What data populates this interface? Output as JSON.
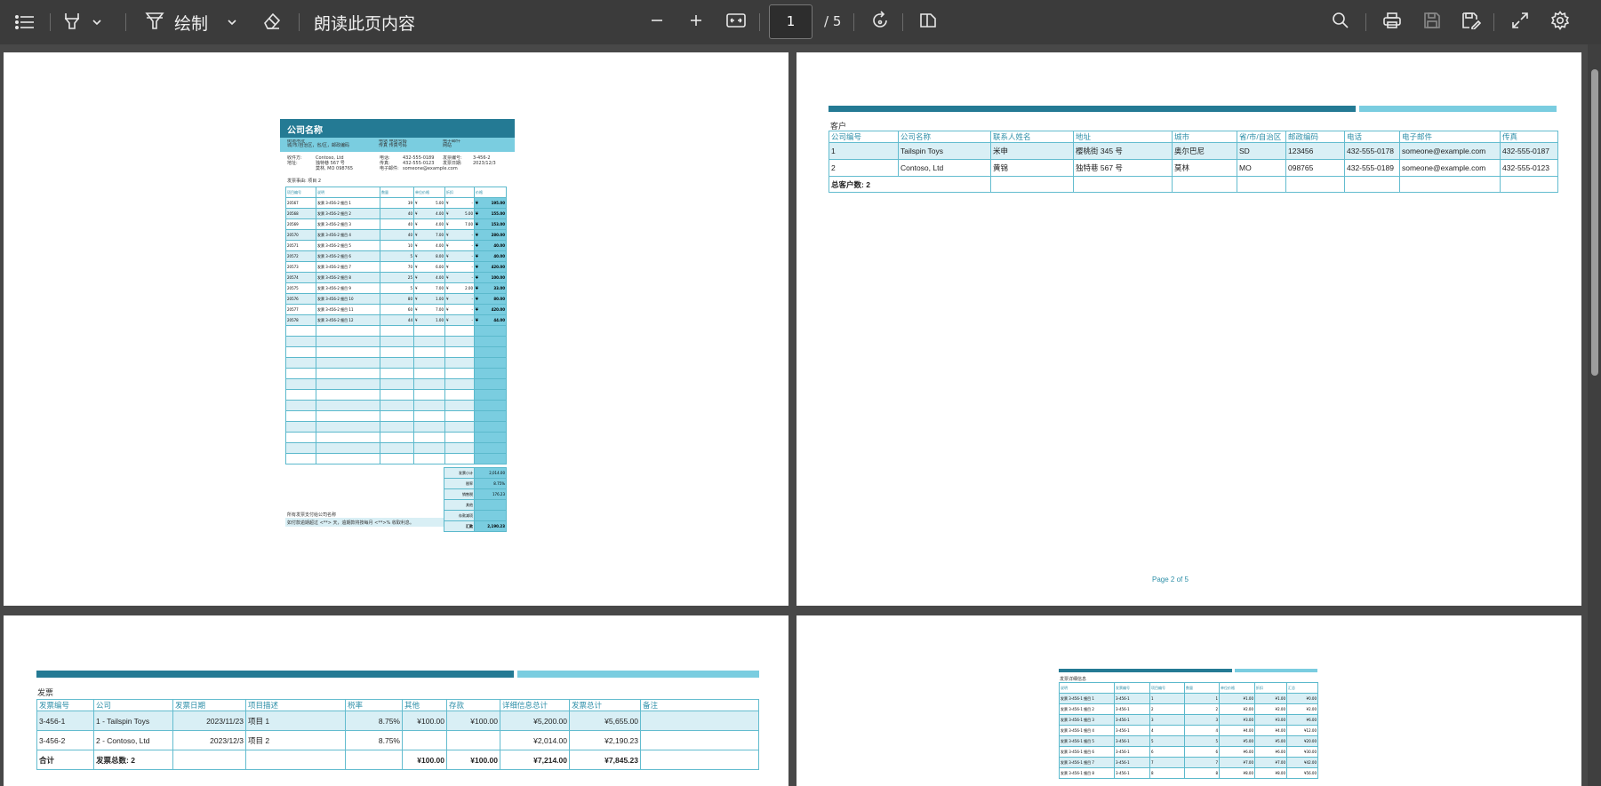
{
  "toolbar": {
    "contents_icon": "list-icon",
    "highlight_icon": "highlighter-icon",
    "draw_label": "绘制",
    "read_aloud_label": "朗读此页内容",
    "current_page": "1",
    "total_pages": "/ 5"
  },
  "colors": {
    "toolbar_bg": "#3b3b3b",
    "viewer_bg": "#484848",
    "accent_dark": "#247a94",
    "accent_light": "#7acde0",
    "table_border": "#63bccf",
    "row_band": "#d9eff5"
  },
  "page1": {
    "company_title": "公司名称",
    "addr_lines": [
      "街道地址",
      "城/市/自治区，省/区，邮政编码"
    ],
    "phone_lines": [
      "电话 电话号码",
      "传真 传真号码"
    ],
    "email_lines": [
      "电子邮件",
      "网站"
    ],
    "bill_to": [
      "收件方:",
      "地址:"
    ],
    "bill_values": [
      "Contoso, Ltd",
      "独特巷 567 号",
      "莫林, MO 098765"
    ],
    "contact": [
      "电话:",
      "传真:",
      "电子邮件:"
    ],
    "contact_values": [
      "432-555-0189",
      "432-555-0123",
      "someone@example.com"
    ],
    "inv_labels": [
      "发票编号:",
      "发票日期:"
    ],
    "inv_values": [
      "3-456-2",
      "2023/12/3"
    ],
    "project": "发票事由:  项目 2",
    "table_headers": [
      "项目编号",
      "说明",
      "数量",
      "单位价格",
      "折扣",
      "价格"
    ],
    "rows": [
      [
        "20567",
        "发票 3-456-2 细目 1",
        "39",
        "¥",
        "5.00",
        "¥",
        "-",
        "¥",
        "195.00"
      ],
      [
        "20568",
        "发票 3-456-2 细目 2",
        "40",
        "¥",
        "4.00",
        "¥",
        "5.00",
        "¥",
        "155.00"
      ],
      [
        "20569",
        "发票 3-456-2 细目 3",
        "40",
        "¥",
        "4.00",
        "¥",
        "7.00",
        "¥",
        "153.00"
      ],
      [
        "20570",
        "发票 3-456-2 细目 4",
        "40",
        "¥",
        "7.00",
        "¥",
        "-",
        "¥",
        "280.00"
      ],
      [
        "20571",
        "发票 3-456-2 细目 5",
        "10",
        "¥",
        "4.00",
        "¥",
        "-",
        "¥",
        "40.00"
      ],
      [
        "20572",
        "发票 3-456-2 细目 6",
        "5",
        "¥",
        "8.00",
        "¥",
        "-",
        "¥",
        "40.00"
      ],
      [
        "20573",
        "发票 3-456-2 细目 7",
        "70",
        "¥",
        "6.00",
        "¥",
        "-",
        "¥",
        "420.00"
      ],
      [
        "20574",
        "发票 3-456-2 细目 8",
        "25",
        "¥",
        "4.00",
        "¥",
        "-",
        "¥",
        "100.00"
      ],
      [
        "20575",
        "发票 3-456-2 细目 9",
        "5",
        "¥",
        "7.00",
        "¥",
        "2.00",
        "¥",
        "33.00"
      ],
      [
        "20576",
        "发票 3-456-2 细目 10",
        "80",
        "¥",
        "1.00",
        "¥",
        "-",
        "¥",
        "80.00"
      ],
      [
        "20577",
        "发票 3-456-2 细目 11",
        "60",
        "¥",
        "7.00",
        "¥",
        "-",
        "¥",
        "420.00"
      ],
      [
        "20578",
        "发票 3-456-2 细目 12",
        "44",
        "¥",
        "1.00",
        "¥",
        "-",
        "¥",
        "44.00"
      ]
    ],
    "summary_labels": [
      "发票小计",
      "税率",
      "销售税",
      "其他",
      "存款减项",
      "汇款"
    ],
    "summary_values": [
      "2,014.00",
      "8.75%",
      "176.23",
      "",
      "",
      "2,190.23"
    ],
    "footer1": "所有发票支付给公司名称",
    "footer2": "如付款逾期超过 <**> 天，逾期款将按每月 <**>% 收取利息。"
  },
  "page2": {
    "section": "客户",
    "headers": [
      "公司编号",
      "公司名称",
      "联系人姓名",
      "地址",
      "城市",
      "省/市/自治区",
      "邮政编码",
      "电话",
      "电子邮件",
      "传真"
    ],
    "rows": [
      [
        "1",
        "Tailspin Toys",
        "米申",
        "樱桃街 345 号",
        "奥尔巴尼",
        "SD",
        "123456",
        "432-555-0178",
        "someone@example.com",
        "432-555-0187"
      ],
      [
        "2",
        "Contoso, Ltd",
        "黄锦",
        "独特巷 567 号",
        "莫林",
        "MO",
        "098765",
        "432-555-0189",
        "someone@example.com",
        "432-555-0123"
      ]
    ],
    "total": "总客户数:  2",
    "footer": "Page 2 of 5"
  },
  "page3": {
    "section": "发票",
    "headers": [
      "发票编号",
      "公司",
      "发票日期",
      "项目描述",
      "税率",
      "其他",
      "存款",
      "详细信息总计",
      "发票总计",
      "备注"
    ],
    "rows": [
      [
        "3-456-1",
        "1 - Tailspin Toys",
        "2023/11/23",
        "项目 1",
        "8.75%",
        "¥100.00",
        "¥100.00",
        "¥5,200.00",
        "¥5,655.00",
        ""
      ],
      [
        "3-456-2",
        "2 - Contoso, Ltd",
        "2023/12/3",
        "项目 2",
        "8.75%",
        "",
        "",
        "¥2,014.00",
        "¥2,190.23",
        ""
      ]
    ],
    "total_label": "合计",
    "total_count": "发票总数:  2",
    "total_other": "¥100.00",
    "total_deposit": "¥100.00",
    "total_detail": "¥7,214.00",
    "total_invoice": "¥7,845.23"
  },
  "page4": {
    "section": "发票详细信息",
    "headers": [
      "说明",
      "发票编号",
      "项目编号",
      "数量",
      "单位价格",
      "折扣",
      "汇总"
    ],
    "rows": [
      [
        "发票 3-456-1 细目 1",
        "3-456-1",
        "1",
        "1",
        "¥1.00",
        "¥1.00",
        "¥0.00"
      ],
      [
        "发票 3-456-1 细目 2",
        "3-456-1",
        "2",
        "2",
        "¥2.00",
        "¥2.00",
        "¥2.00"
      ],
      [
        "发票 3-456-1 细目 3",
        "3-456-1",
        "3",
        "3",
        "¥3.00",
        "¥3.00",
        "¥6.00"
      ],
      [
        "发票 3-456-1 细目 4",
        "3-456-1",
        "4",
        "4",
        "¥4.00",
        "¥4.00",
        "¥12.00"
      ],
      [
        "发票 3-456-1 细目 5",
        "3-456-1",
        "5",
        "5",
        "¥5.00",
        "¥5.00",
        "¥20.00"
      ],
      [
        "发票 3-456-1 细目 6",
        "3-456-1",
        "6",
        "6",
        "¥6.00",
        "¥6.00",
        "¥30.00"
      ],
      [
        "发票 3-456-1 细目 7",
        "3-456-1",
        "7",
        "7",
        "¥7.00",
        "¥7.00",
        "¥42.00"
      ],
      [
        "发票 3-456-1 细目 8",
        "3-456-1",
        "8",
        "8",
        "¥8.00",
        "¥8.00",
        "¥56.00"
      ]
    ]
  }
}
